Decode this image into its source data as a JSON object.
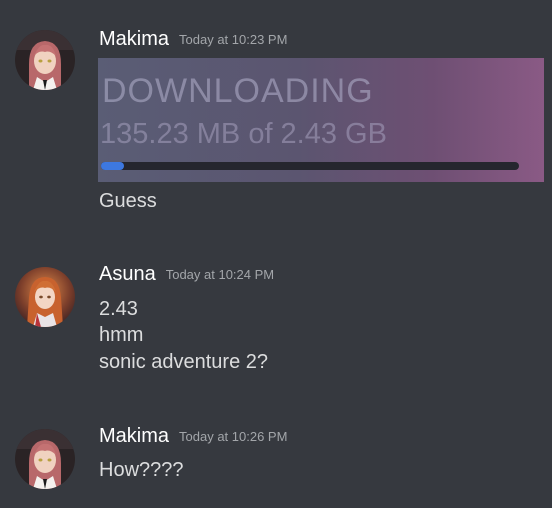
{
  "messages": [
    {
      "username": "Makima",
      "timestamp": "Today at 10:23 PM",
      "avatar": "makima-avatar",
      "attachment": {
        "title": "DOWNLOADING",
        "size_text": "135.23 MB of 2.43 GB",
        "progress_fraction": 0.054,
        "bar_color": "#3d78e0"
      },
      "lines": [
        "Guess"
      ]
    },
    {
      "username": "Asuna",
      "timestamp": "Today at 10:24 PM",
      "avatar": "asuna-avatar",
      "lines": [
        "2.43",
        "hmm",
        "sonic adventure 2?"
      ]
    },
    {
      "username": "Makima",
      "timestamp": "Today at 10:26 PM",
      "avatar": "makima-avatar",
      "lines": [
        "How????"
      ]
    }
  ],
  "colors": {
    "background": "#36393f",
    "username": "#ffffff",
    "timestamp": "#a3a6aa",
    "text": "#dcddde"
  }
}
